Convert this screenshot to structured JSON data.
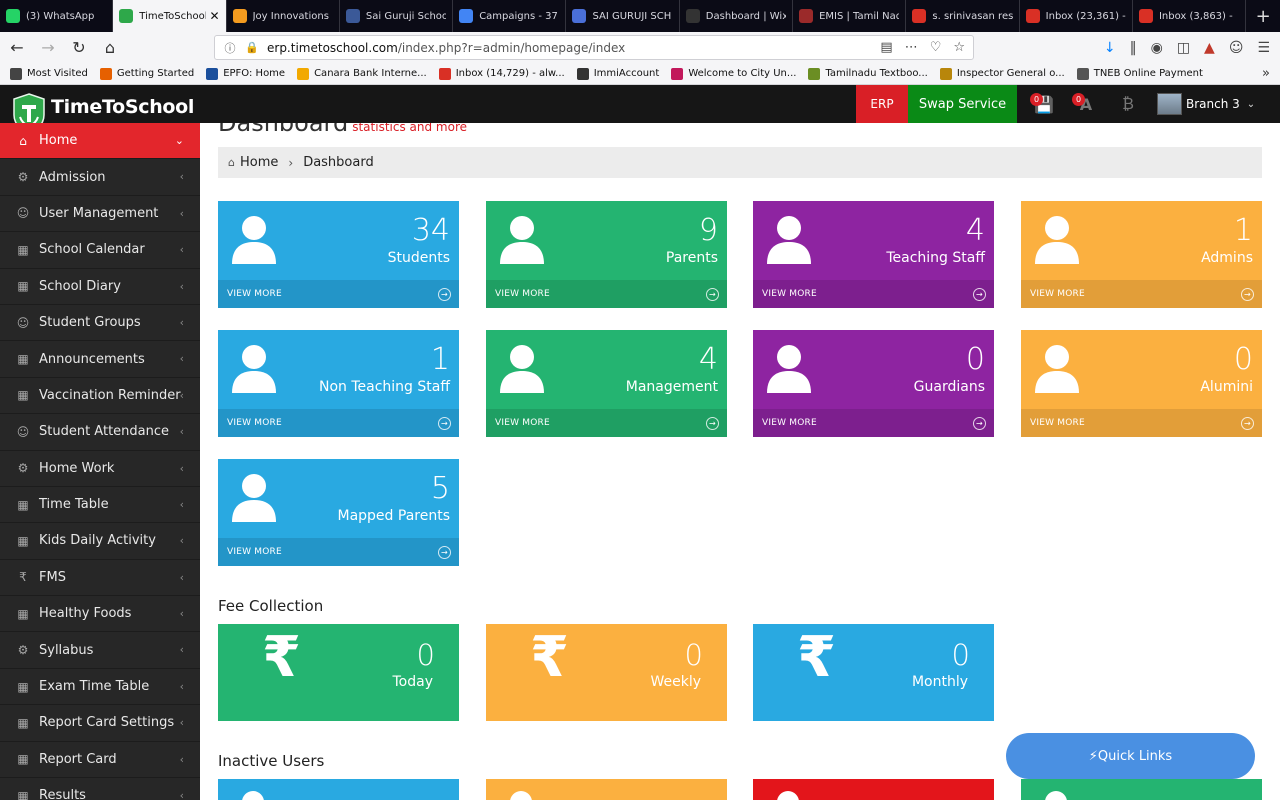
{
  "browser": {
    "tabs": [
      {
        "label": "(3) WhatsApp",
        "icon": "whatsapp-icon",
        "color": "#25d366"
      },
      {
        "label": "TimeToSchool",
        "icon": "timetoschool-icon",
        "color": "#2ea84a",
        "active": true
      },
      {
        "label": "Joy Innovations",
        "icon": "joy-icon",
        "color": "#f49b1f"
      },
      {
        "label": "Sai Guruji School",
        "icon": "facebook-icon",
        "color": "#3b5998"
      },
      {
        "label": "Campaigns - 37",
        "icon": "google-ads-icon",
        "color": "#4285f4"
      },
      {
        "label": "SAI GURUJI SCH",
        "icon": "people-icon",
        "color": "#4a6fd8"
      },
      {
        "label": "Dashboard | Wix",
        "icon": "wix-icon",
        "color": "#333333"
      },
      {
        "label": "EMIS | Tamil Nadu",
        "icon": "emis-icon",
        "color": "#9b2a2a"
      },
      {
        "label": "s. srinivasan res",
        "icon": "gmail-icon",
        "color": "#d93025"
      },
      {
        "label": "Inbox (23,361) -",
        "icon": "gmail-icon",
        "color": "#d93025"
      },
      {
        "label": "Inbox (3,863) -",
        "icon": "gmail-icon",
        "color": "#d93025"
      }
    ],
    "url_host": "erp.timetoschool.com",
    "url_path": "/index.php?r=admin/homepage/index",
    "bookmarks": [
      {
        "label": "Most Visited",
        "color": "#444444"
      },
      {
        "label": "Getting Started",
        "color": "#e66000"
      },
      {
        "label": "EPFO: Home",
        "color": "#1b4f9c"
      },
      {
        "label": "Canara Bank Interne...",
        "color": "#f2a900"
      },
      {
        "label": "Inbox (14,729) - alw...",
        "color": "#d93025"
      },
      {
        "label": "ImmiAccount",
        "color": "#333333"
      },
      {
        "label": "Welcome to City Un...",
        "color": "#c2185b"
      },
      {
        "label": "Tamilnadu Textboo...",
        "color": "#6b8e23"
      },
      {
        "label": "Inspector General o...",
        "color": "#b8860b"
      },
      {
        "label": "TNEB Online Payment",
        "color": "#555555"
      }
    ]
  },
  "header": {
    "brand": "TimeToSchool",
    "erp": "ERP",
    "swap": "Swap Service",
    "badge1": "0",
    "badge2": "0",
    "branch": "Branch 3"
  },
  "sidebar": {
    "items": [
      {
        "label": "Home",
        "icon": "home-icon",
        "active": true
      },
      {
        "label": "Admission",
        "icon": "cogs-icon"
      },
      {
        "label": "User Management",
        "icon": "user-icon"
      },
      {
        "label": "School Calendar",
        "icon": "calendar-icon"
      },
      {
        "label": "School Diary",
        "icon": "calendar-icon"
      },
      {
        "label": "Student Groups",
        "icon": "user-icon"
      },
      {
        "label": "Announcements",
        "icon": "calendar-icon"
      },
      {
        "label": "Vaccination Reminder",
        "icon": "calendar-icon"
      },
      {
        "label": "Student Attendance",
        "icon": "user-icon"
      },
      {
        "label": "Home Work",
        "icon": "cogs-icon"
      },
      {
        "label": "Time Table",
        "icon": "calendar-icon"
      },
      {
        "label": "Kids Daily Activity",
        "icon": "calendar-icon"
      },
      {
        "label": "FMS",
        "icon": "rupee-icon"
      },
      {
        "label": "Healthy Foods",
        "icon": "calendar-icon"
      },
      {
        "label": "Syllabus",
        "icon": "cogs-icon"
      },
      {
        "label": "Exam Time Table",
        "icon": "calendar-icon"
      },
      {
        "label": "Report Card Settings",
        "icon": "calendar-icon"
      },
      {
        "label": "Report Card",
        "icon": "calendar-icon"
      },
      {
        "label": "Results",
        "icon": "calendar-icon"
      }
    ]
  },
  "page": {
    "title": "Dashboard",
    "subtitle": "statistics and more",
    "breadcrumb_home": "Home",
    "breadcrumb_current": "Dashboard",
    "view_more": "VIEW MORE"
  },
  "stats": [
    {
      "value": "34",
      "label": "Students",
      "color": "blue"
    },
    {
      "value": "9",
      "label": "Parents",
      "color": "green"
    },
    {
      "value": "4",
      "label": "Teaching Staff",
      "color": "purple"
    },
    {
      "value": "1",
      "label": "Admins",
      "color": "orange"
    },
    {
      "value": "1",
      "label": "Non Teaching Staff",
      "color": "blue"
    },
    {
      "value": "4",
      "label": "Management",
      "color": "green"
    },
    {
      "value": "0",
      "label": "Guardians",
      "color": "purple"
    },
    {
      "value": "0",
      "label": "Alumini",
      "color": "orange"
    },
    {
      "value": "5",
      "label": "Mapped Parents",
      "color": "blue"
    }
  ],
  "fee_section": "Fee Collection",
  "fees": [
    {
      "value": "0",
      "label": "Today",
      "color": "#24b471"
    },
    {
      "value": "0",
      "label": "Weekly",
      "color": "#fbb040"
    },
    {
      "value": "0",
      "label": "Monthly",
      "color": "#29a9e1"
    }
  ],
  "inactive_section": "Inactive Users",
  "quick_links": "Quick Links"
}
